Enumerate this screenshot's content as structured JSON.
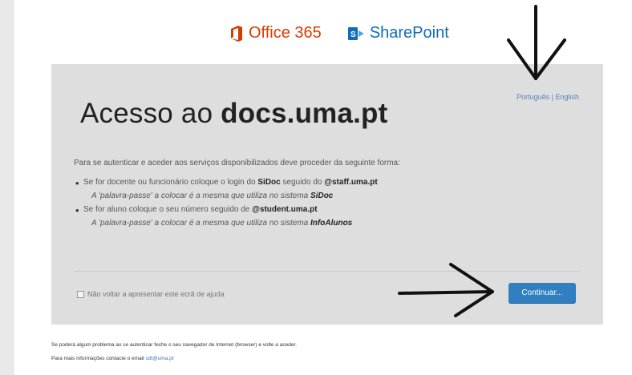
{
  "logos": {
    "office": "Office 365",
    "sharepoint": "SharePoint"
  },
  "lang": {
    "pt": "Português",
    "sep": " | ",
    "en": "English"
  },
  "title": {
    "prefix": "Acesso ao ",
    "bold": "docs.uma.pt"
  },
  "intro": "Para se autenticar e aceder aos serviços disponibilizados deve proceder da seguinte forma:",
  "bullets": {
    "staff": {
      "a": "Se for docente ou funcionário coloque o login do ",
      "b1": "SiDoc",
      "c": " seguido do ",
      "b2": "@staff.uma.pt"
    },
    "staff_note": {
      "a": "A 'palavra-passe' a colocar é a mesma que utiliza no sistema ",
      "b": "SiDoc"
    },
    "student": {
      "a": "Se for aluno coloque o seu número seguido de ",
      "b": "@student.uma.pt"
    },
    "student_note": {
      "a": "A 'palavra-passe' a colocar é a mesma que utiliza no sistema ",
      "b": "InfoAlunos"
    }
  },
  "checkbox_label": "Não voltar a apresentar este ecrã de ajuda",
  "button": "Continuar...",
  "footer": {
    "line1": "Se poderá algum problema ao se autenticar feche o seu navegador de Internet (browser) e volte a aceder.",
    "line2": "Para mais informações contacte o email ",
    "email": "sdt@uma.pt"
  },
  "colors": {
    "accent": "#2f7fc1",
    "office": "#d83b01",
    "sharepoint": "#0f6cbd"
  }
}
